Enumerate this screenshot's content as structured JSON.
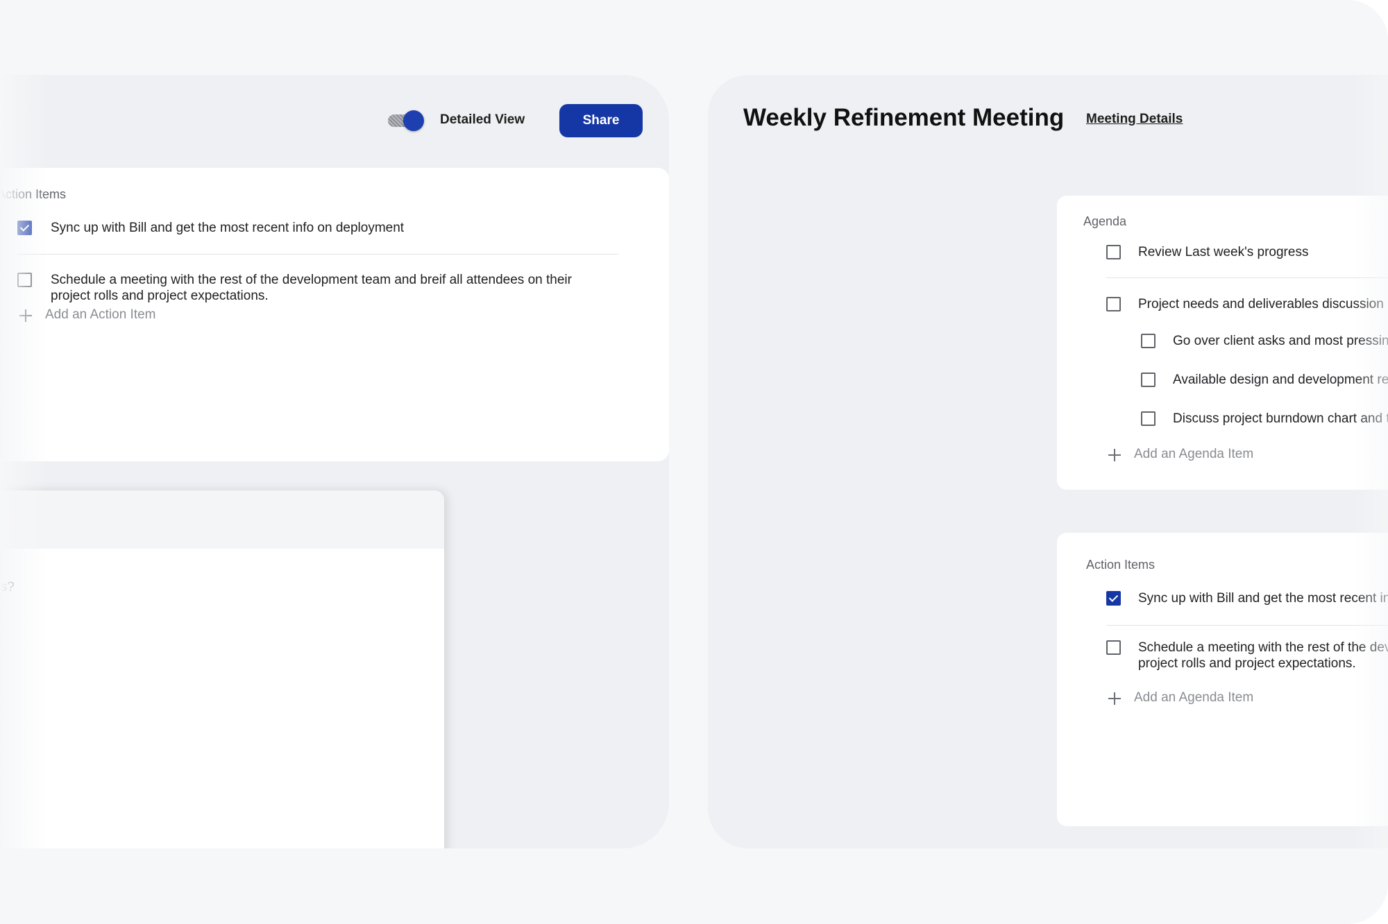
{
  "header": {
    "toggle_label": "Detailed View",
    "toggle_on": true,
    "share_label": "Share"
  },
  "left_action_items": {
    "title": "Action Items",
    "items": [
      {
        "text": "Sync up with Bill and get the most recent info on deployment",
        "checked": true
      },
      {
        "text_line1": "Schedule a meeting with the rest of the development team and breif all attendees on their",
        "text_line2": "project rolls and project expectations.",
        "checked": false
      }
    ],
    "add_label": "Add an Action Item"
  },
  "notes": {
    "text": "gs?"
  },
  "meeting": {
    "title": "Weekly Refinement Meeting",
    "details_link": "Meeting Details"
  },
  "agenda": {
    "title": "Agenda",
    "items": [
      {
        "text": "Review Last week's progress",
        "checked": false
      },
      {
        "text": "Project needs and deliverables discussion",
        "checked": false
      },
      {
        "text": "Go over client asks and most pressing needs",
        "checked": false
      },
      {
        "text": "Available design and development resources",
        "checked": false
      },
      {
        "text": "Discuss project burndown chart and timeline",
        "checked": false
      }
    ],
    "add_label": "Add an Agenda Item"
  },
  "right_action_items": {
    "title": "Action Items",
    "items": [
      {
        "text": "Sync up with Bill and get the most recent info on deployment",
        "checked": true
      },
      {
        "text_line1": "Schedule a meeting with the rest of the development team",
        "text_line2": "project rolls and project expectations.",
        "checked": false
      }
    ],
    "add_label": "Add an Agenda Item"
  },
  "colors": {
    "accent": "#1537a5",
    "panel_bg": "#eef0f3",
    "card_bg": "#ffffff",
    "outer_bg": "#f6f7f9"
  }
}
